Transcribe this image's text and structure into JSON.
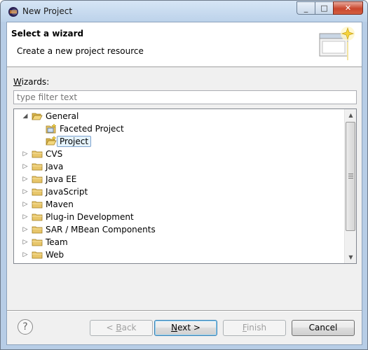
{
  "window": {
    "title": "New Project",
    "controls": [
      "_",
      "□",
      "✕"
    ]
  },
  "header": {
    "title": "Select a wizard",
    "description": "Create a new project resource"
  },
  "wizards": {
    "label_accel": "W",
    "label_rest": "izards:",
    "filter_placeholder": "type filter text"
  },
  "tree": [
    {
      "label": "General",
      "expanded": true,
      "level": 0,
      "icon": "folder-open-icon"
    },
    {
      "label": "Faceted Project",
      "level": 1,
      "icon": "faceted-project-icon"
    },
    {
      "label": "Project",
      "level": 1,
      "icon": "project-icon",
      "selected": true
    },
    {
      "label": "CVS",
      "expanded": false,
      "level": 0,
      "icon": "folder-icon"
    },
    {
      "label": "Java",
      "expanded": false,
      "level": 0,
      "icon": "folder-icon"
    },
    {
      "label": "Java EE",
      "expanded": false,
      "level": 0,
      "icon": "folder-icon"
    },
    {
      "label": "JavaScript",
      "expanded": false,
      "level": 0,
      "icon": "folder-icon"
    },
    {
      "label": "Maven",
      "expanded": false,
      "level": 0,
      "icon": "folder-icon"
    },
    {
      "label": "Plug-in Development",
      "expanded": false,
      "level": 0,
      "icon": "folder-icon"
    },
    {
      "label": "SAR / MBean Components",
      "expanded": false,
      "level": 0,
      "icon": "folder-icon"
    },
    {
      "label": "Team",
      "expanded": false,
      "level": 0,
      "icon": "folder-icon"
    },
    {
      "label": "Web",
      "expanded": false,
      "level": 0,
      "icon": "folder-icon"
    }
  ],
  "buttons": {
    "back_prefix": "< ",
    "back_accel": "B",
    "back_rest": "ack",
    "next_accel": "N",
    "next_rest": "ext >",
    "finish_accel": "F",
    "finish_rest": "inish",
    "cancel": "Cancel",
    "help": "?"
  },
  "colors": {
    "selection_bg": "#e5f3fb",
    "selection_border": "#7da2ce",
    "folder": "#e8c66a"
  }
}
